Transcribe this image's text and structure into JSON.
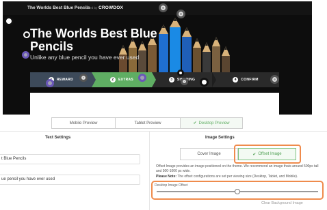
{
  "preview": {
    "brand_title": "The Worlds Best Blue Pencils",
    "powered_label": "powered by",
    "powered_logo": "CROWDOX",
    "headline": "The Worlds Best Blue Pencils",
    "subhead": "Unlike any blue pencil you have ever used",
    "steps": [
      {
        "num": "1",
        "label": "REWARD"
      },
      {
        "num": "2",
        "label": "EXTRAS"
      },
      {
        "num": "3",
        "label": "SHIPPING"
      },
      {
        "num": "4",
        "label": "CONFIRM"
      }
    ]
  },
  "preview_tabs": {
    "mobile": "Mobile Preview",
    "tablet": "Tablet Preview",
    "desktop": "Desktop Preview",
    "active": "desktop"
  },
  "text_settings": {
    "title": "Text Settings",
    "title_value": "t Blue Pencils",
    "subtitle_value": "ue pencil you have ever used"
  },
  "image_settings": {
    "title": "Image Settings",
    "cover_label": "Cover Image",
    "offset_label": "Offset Image",
    "active": "offset",
    "description": "Offset Image provides an image positioned on the theme. We recommend an image thats around 500px tall and 500-1000 px wide.",
    "note_label": "Please Note:",
    "note_text": "The offset configurations are set per viewing size (Desktop, Tablet, and Mobile).",
    "desktop_offset_label": "Desktop Image Offset",
    "desktop_offset_value": 0.5,
    "clear_background": "Clear Background Image"
  },
  "colors": {
    "accent_green": "#5fae63",
    "highlight_orange": "#ef8b4c",
    "hero_background": "#0d0d0d"
  }
}
